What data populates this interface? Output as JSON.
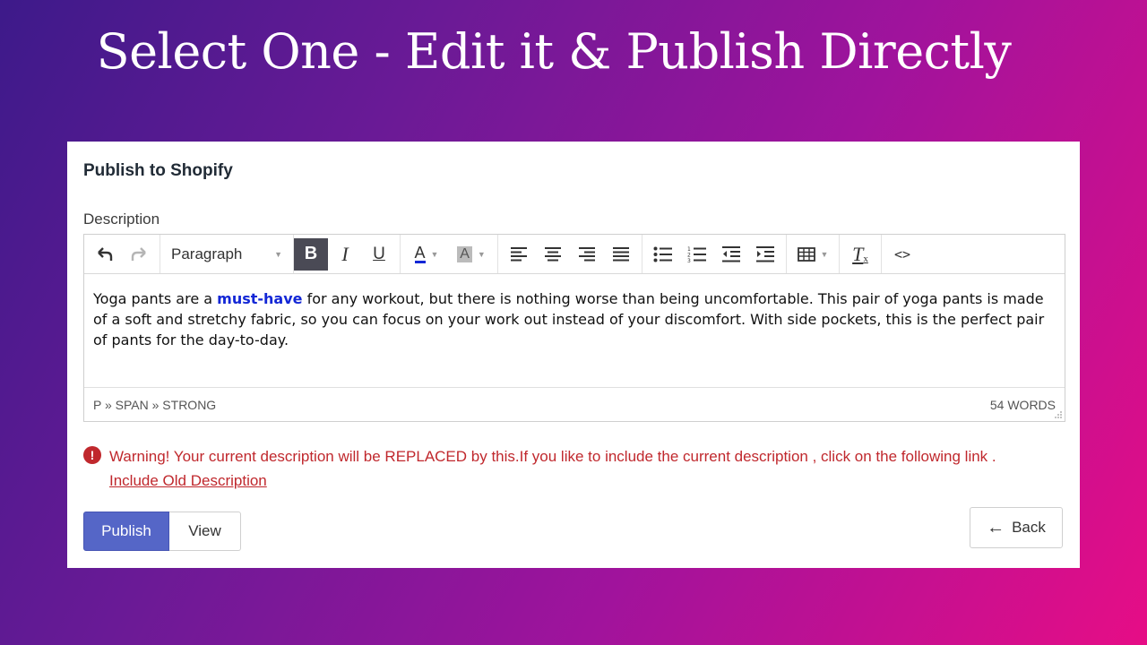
{
  "headline": "Select One - Edit it & Publish Directly",
  "card": {
    "title": "Publish to Shopify",
    "description_label": "Description"
  },
  "toolbar": {
    "format_select": "Paragraph",
    "bold_glyph": "B",
    "italic_glyph": "I",
    "underline_glyph": "U",
    "text_color_glyph": "A",
    "bg_color_glyph": "A",
    "clear_format_glyph": "T",
    "code_glyph": "<>"
  },
  "editor": {
    "text_before": "Yoga pants are a ",
    "text_strong": "must-have",
    "text_after": " for any workout, but there is nothing worse than being uncomfortable. This pair of yoga pants is made of a soft and stretchy fabric, so you can focus on your work out instead of your discomfort. With side pockets, this is the perfect pair of pants for the day-to-day.",
    "path": "P » SPAN » STRONG",
    "word_count": "54 WORDS"
  },
  "warning": {
    "text": "Warning! Your current description will be REPLACED by this.If you like to include the current description , click on the following link .",
    "link": "Include Old Description"
  },
  "buttons": {
    "publish": "Publish",
    "view": "View",
    "back": "Back"
  },
  "colors": {
    "publish_bg": "#5566c7",
    "warning": "#c0282d",
    "strong_text": "#1327d6"
  }
}
